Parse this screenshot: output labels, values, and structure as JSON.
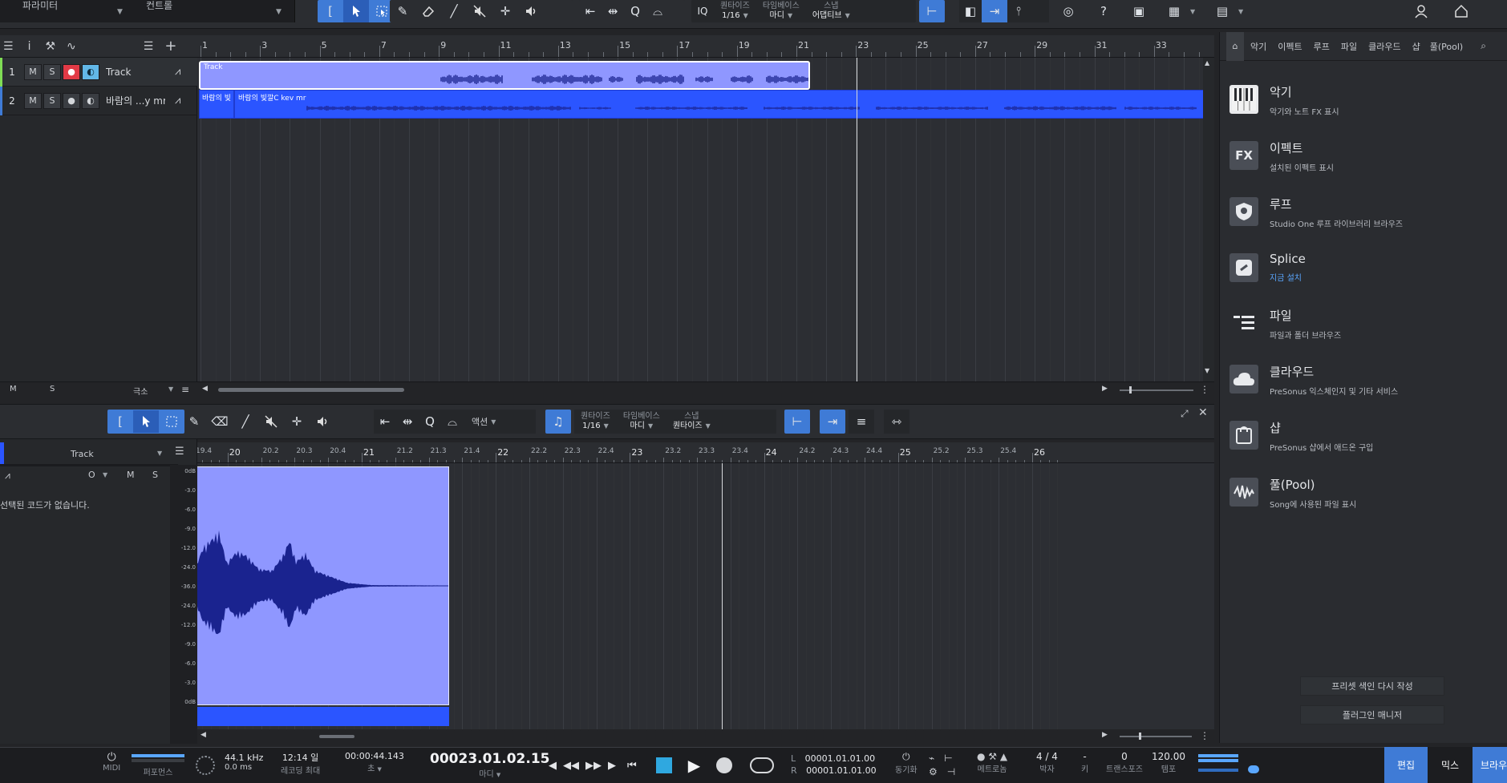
{
  "top_tabs": [
    "파라미터",
    "컨트롤"
  ],
  "quantize": {
    "label": "퀀타이즈",
    "value": "1/16"
  },
  "timebase": {
    "label": "타임베이스",
    "value": "마디"
  },
  "snap": {
    "label": "스냅",
    "value": "어댑티브"
  },
  "iq_label": "IQ",
  "ruler_marks": [
    "1",
    "3",
    "5",
    "7",
    "9",
    "11",
    "13",
    "15",
    "17",
    "19",
    "21",
    "23",
    "25",
    "27",
    "29",
    "31",
    "33"
  ],
  "tracks": [
    {
      "num": "1",
      "name": "Track",
      "rec_active": true,
      "clip_label": "Track"
    },
    {
      "num": "2",
      "name": "바람의 ...y mr",
      "rec_active": false,
      "clip_label_1": "바람의 빛",
      "clip_label_2": "바람의 빛깔C kev mr"
    }
  ],
  "arrange_footer": {
    "m": "M",
    "s": "S",
    "size": "극소"
  },
  "browser": {
    "tabs": [
      "악기",
      "이펙트",
      "루프",
      "파일",
      "클라우드",
      "샵",
      "풀(Pool)"
    ],
    "items": [
      {
        "icon": "piano-icon",
        "title": "악기",
        "subtitle": "악기와 노트 FX 표시"
      },
      {
        "icon": "fx-icon",
        "glyph": "FX",
        "title": "이펙트",
        "subtitle": "설치된 이펙트 표시"
      },
      {
        "icon": "loop-shield-icon",
        "title": "루프",
        "subtitle": "Studio One 루프 라이브러리 브라우즈"
      },
      {
        "icon": "splice-icon",
        "title": "Splice",
        "subtitle": "지금 설치"
      },
      {
        "icon": "file-list-icon",
        "title": "파일",
        "subtitle": "파일과 폴더 브라우즈"
      },
      {
        "icon": "cloud-icon",
        "title": "클라우드",
        "subtitle": "PreSonus 익스체인지 및 기타 서비스"
      },
      {
        "icon": "shop-icon",
        "title": "샵",
        "subtitle": "PreSonus 샵에서 애드온 구입"
      },
      {
        "icon": "pool-icon",
        "title": "풀(Pool)",
        "subtitle": "Song에 사용된 파일 표시"
      }
    ],
    "buttons": [
      "프리셋 색인 다시 작성",
      "플러그인 매니저"
    ]
  },
  "editor": {
    "action_label": "액션",
    "quantize": {
      "label": "퀀타이즈",
      "value": "1/16"
    },
    "timebase": {
      "label": "타임베이스",
      "value": "마디"
    },
    "snap": {
      "label": "스냅",
      "value": "퀀타이즈"
    },
    "track_name": "Track",
    "no_chord": "선택된 코드가 없습니다.",
    "controls": {
      "o": "O",
      "m": "M",
      "s": "S"
    },
    "ruler_marks": [
      "19.4",
      "20",
      "20.2",
      "20.3",
      "20.4",
      "21",
      "21.2",
      "21.3",
      "21.4",
      "22",
      "22.2",
      "22.3",
      "22.4",
      "23",
      "23.2",
      "23.3",
      "23.4",
      "24",
      "24.2",
      "24.3",
      "24.4",
      "25",
      "25.2",
      "25.3",
      "25.4",
      "26"
    ],
    "db_scale": [
      "0dB",
      "-3.0",
      "-6.0",
      "-9.0",
      "-12.0",
      "-24.0",
      "-36.0",
      "-24.0",
      "-12.0",
      "-9.0",
      "-6.0",
      "-3.0",
      "0dB"
    ]
  },
  "transport": {
    "midi": "MIDI",
    "performance": "퍼포먼스",
    "sample_rate": "44.1 kHz",
    "latency": "0.0 ms",
    "record_max": "12:14 일",
    "record_max_label": "레코딩 최대",
    "time_sec": "00:00:44.143",
    "time_sec_unit": "초",
    "position": "00023.01.02.15",
    "position_unit": "마디",
    "loop_l": "00001.01.01.00",
    "loop_r": "00001.01.01.00",
    "l_label": "L",
    "r_label": "R",
    "sync_label": "동기화",
    "metronome_label": "메트로놈",
    "time_sig": "4 / 4",
    "time_sig_label": "박자",
    "key": "-",
    "key_label": "키",
    "transpose": "0",
    "transpose_label": "트랜스포즈",
    "tempo": "120.00",
    "tempo_label": "템포"
  },
  "modes": [
    "편집",
    "믹스",
    "브라우즈"
  ],
  "colors": {
    "accent": "#3f7bd6",
    "clip_light": "#8f97ff",
    "clip_blue": "#2b55ff",
    "waveform": "#1a238f",
    "rec": "#e23a46"
  }
}
